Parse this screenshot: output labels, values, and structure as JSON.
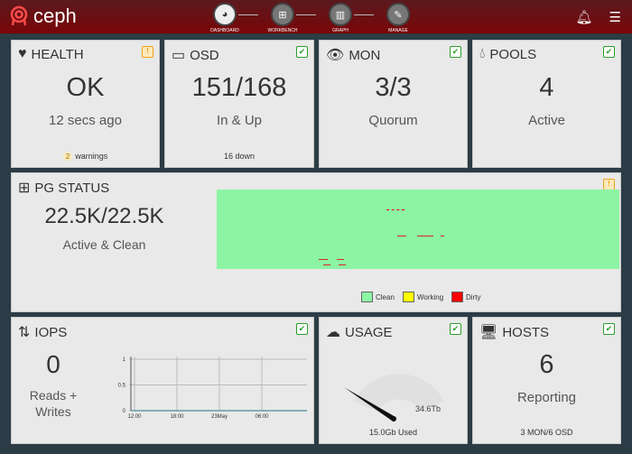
{
  "topbar": {
    "brand": "ceph",
    "nav": [
      {
        "label": "DASHBOARD",
        "icon": "dashboard-icon"
      },
      {
        "label": "WORKBENCH",
        "icon": "sitemap-icon"
      },
      {
        "label": "GRAPH",
        "icon": "bar-chart-icon"
      },
      {
        "label": "MANAGE",
        "icon": "wrench-icon"
      }
    ]
  },
  "health": {
    "title": "HEALTH",
    "value": "OK",
    "sub": "12 secs ago",
    "warn_count": "2",
    "warn_label": "warnings"
  },
  "osd": {
    "title": "OSD",
    "value": "151/168",
    "sub": "In & Up",
    "foot": "16 down"
  },
  "mon": {
    "title": "MON",
    "value": "3/3",
    "sub": "Quorum"
  },
  "pools": {
    "title": "POOLS",
    "value": "4",
    "sub": "Active"
  },
  "pg": {
    "title": "PG STATUS",
    "value": "22.5K/22.5K",
    "sub": "Active & Clean",
    "legend": [
      {
        "label": "Clean",
        "color": "#8cf5a4"
      },
      {
        "label": "Working",
        "color": "#ffff00"
      },
      {
        "label": "Dirty",
        "color": "#ff0000"
      }
    ]
  },
  "iops": {
    "title": "IOPS",
    "value": "0",
    "sub1": "Reads +",
    "sub2": "Writes"
  },
  "usage": {
    "title": "USAGE",
    "total": "34.6Tb",
    "used": "15.0Gb Used"
  },
  "hosts": {
    "title": "HOSTS",
    "value": "6",
    "sub": "Reporting",
    "foot": "3 MON/6 OSD"
  },
  "chart_data": {
    "type": "line",
    "title": "IOPS",
    "x_ticks": [
      "12:00",
      "18:00",
      "23May",
      "06:00"
    ],
    "y_ticks": [
      "0",
      "0.5",
      "1"
    ],
    "ylim": [
      0,
      1
    ],
    "series": [
      {
        "name": "iops",
        "values": [
          0,
          0,
          0,
          0,
          0
        ]
      }
    ]
  }
}
